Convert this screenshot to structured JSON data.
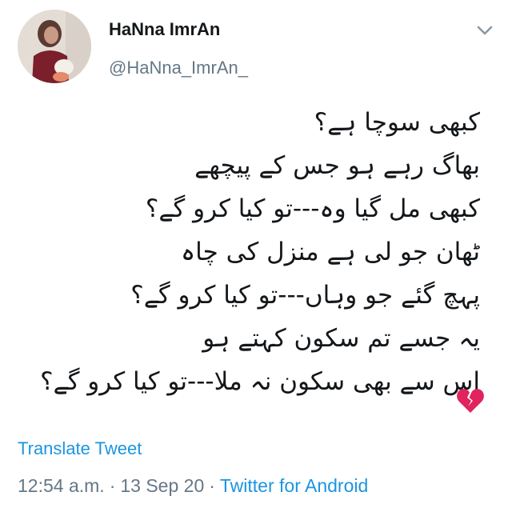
{
  "tweet": {
    "author": {
      "display_name": "HaNna ImrAn",
      "handle": "@HaNna_ImrAn_"
    },
    "lines": [
      "کبھی سوچا ہے؟",
      "بھاگ رہے ہو جس کے پیچھے",
      "کبھی مل گیا وہ---تو کیا کرو گے؟",
      "ٹھان جو لی ہے منزل کی چاہ",
      "پہچ گئے جو وہاں---تو کیا کرو گے؟",
      "یہ جسے تم سکون کہتے ہو",
      "اس سے بھی سکون نہ ملا---تو کیا کرو گے؟"
    ],
    "emoji_icon": "broken-heart-icon",
    "translate_label": "Translate Tweet",
    "time": "12:54 a.m.",
    "separator": "·",
    "date": "13 Sep 20",
    "source": "Twitter for Android"
  },
  "colors": {
    "text": "#14171a",
    "secondary": "#657786",
    "link": "#1b95e0",
    "heart": "#e0245e"
  }
}
